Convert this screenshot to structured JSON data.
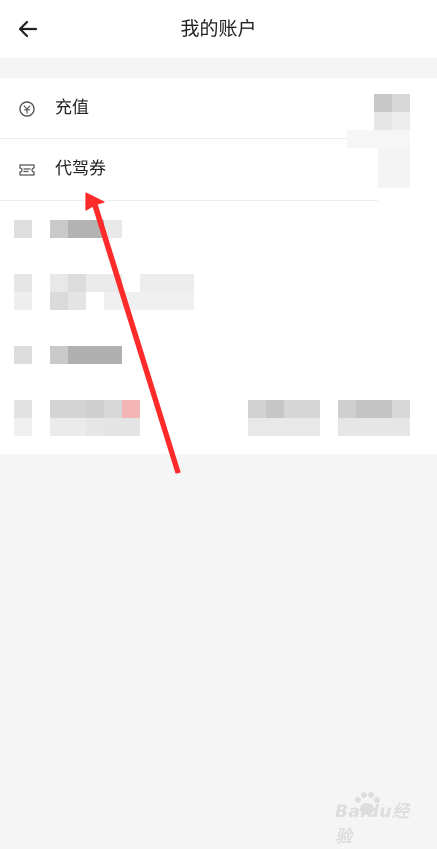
{
  "header": {
    "title": "我的账户",
    "back_icon": "arrow-left-icon"
  },
  "menu": {
    "items": [
      {
        "label": "充值",
        "icon": "coin-icon"
      },
      {
        "label": "代驾券",
        "icon": "ticket-icon"
      }
    ]
  },
  "annotation": {
    "arrow_color": "#ff2a2a"
  },
  "watermark": {
    "text": "Baidu经验",
    "icon": "paw-icon"
  }
}
